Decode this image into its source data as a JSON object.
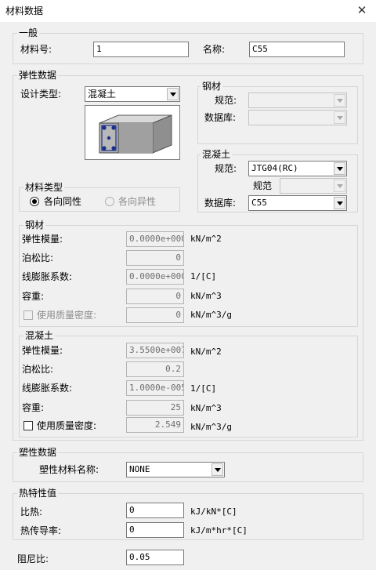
{
  "window": {
    "title": "材料数据",
    "close_glyph": "✕"
  },
  "general": {
    "legend": "一般",
    "material_no_label": "材料号:",
    "material_no_value": "1",
    "name_label": "名称:",
    "name_value": "C55"
  },
  "elastic": {
    "legend": "弹性数据",
    "design_type_label": "设计类型:",
    "design_type_value": "混凝土",
    "material_type": {
      "legend": "材料类型",
      "isotropic_label": "各向同性",
      "anisotropic_label": "各向异性",
      "selected": "isotropic"
    },
    "steel_group": {
      "legend": "钢材",
      "code_label": "规范:",
      "code_value": "",
      "db_label": "数据库:",
      "db_value": ""
    },
    "concrete_group": {
      "legend": "混凝土",
      "code_label": "规范:",
      "code_value": "JTG04(RC)",
      "subcode_label": "规范",
      "subcode_value": "",
      "db_label": "数据库:",
      "db_value": "C55"
    },
    "steel_props": {
      "legend": "钢材",
      "elastic_modulus_label": "弹性模量:",
      "elastic_modulus_value": "0.0000e+000",
      "elastic_modulus_unit": "kN/m^2",
      "poisson_label": "泊松比:",
      "poisson_value": "0",
      "expansion_label": "线膨胀系数:",
      "expansion_value": "0.0000e+000",
      "expansion_unit": "1/[C]",
      "weight_label": "容重:",
      "weight_value": "0",
      "weight_unit": "kN/m^3",
      "use_mass_density_label": "使用质量密度:",
      "mass_density_value": "0",
      "mass_density_unit": "kN/m^3/g"
    },
    "concrete_props": {
      "legend": "混凝土",
      "elastic_modulus_label": "弹性模量:",
      "elastic_modulus_value": "3.5500e+007",
      "elastic_modulus_unit": "kN/m^2",
      "poisson_label": "泊松比:",
      "poisson_value": "0.2",
      "expansion_label": "线膨胀系数:",
      "expansion_value": "1.0000e-005",
      "expansion_unit": "1/[C]",
      "weight_label": "容重:",
      "weight_value": "25",
      "weight_unit": "kN/m^3",
      "use_mass_density_label": "使用质量密度:",
      "mass_density_value": "2.549",
      "mass_density_unit": "kN/m^3/g"
    }
  },
  "plastic": {
    "legend": "塑性数据",
    "material_name_label": "塑性材料名称:",
    "material_name_value": "NONE"
  },
  "thermal": {
    "legend": "热特性值",
    "specific_heat_label": "比热:",
    "specific_heat_value": "0",
    "specific_heat_unit": "kJ/kN*[C]",
    "conductivity_label": "热传导率:",
    "conductivity_value": "0",
    "conductivity_unit": "kJ/m*hr*[C]"
  },
  "damping": {
    "label": "阻尼比:",
    "value": "0.05"
  },
  "colors": {
    "window_bg": "#f0f0f0",
    "group_border": "#d5d5d5",
    "disabled_text": "#8c8c8c"
  }
}
